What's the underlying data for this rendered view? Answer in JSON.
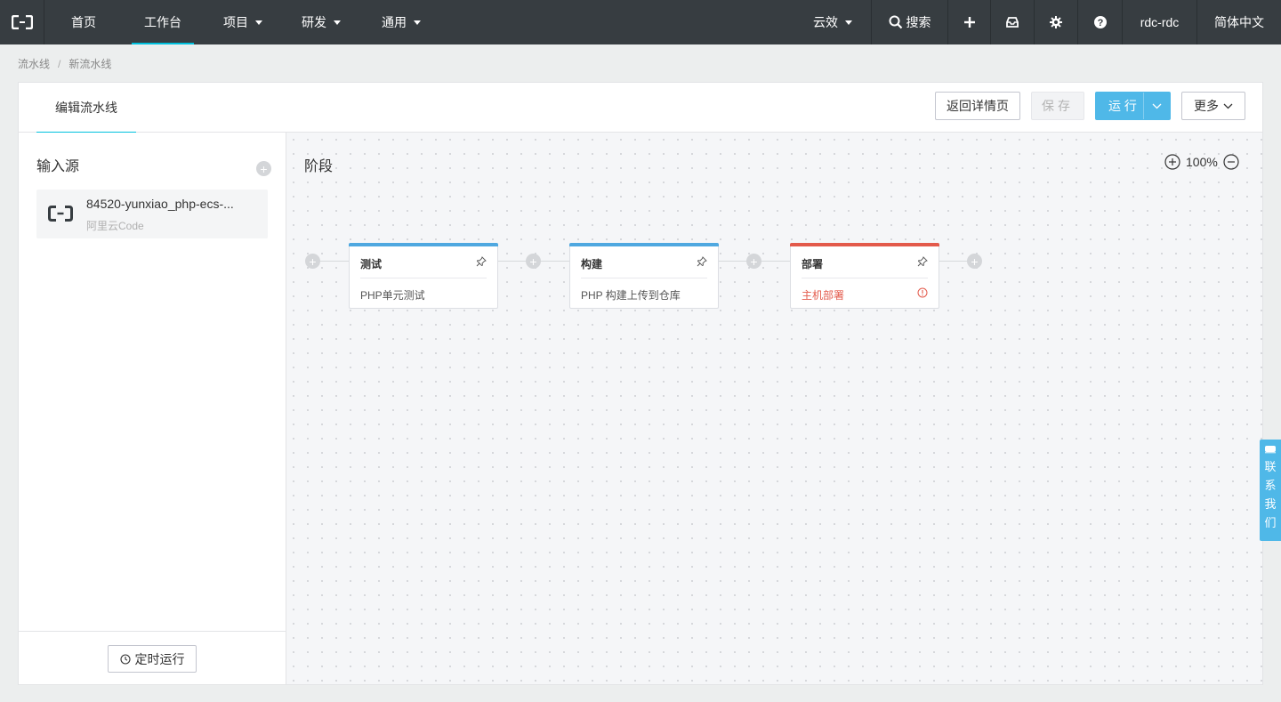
{
  "topbar": {
    "nav": [
      {
        "label": "首页"
      },
      {
        "label": "工作台"
      },
      {
        "label": "项目"
      },
      {
        "label": "研发"
      },
      {
        "label": "通用"
      }
    ],
    "org_label": "云效",
    "search_label": "搜索",
    "user_label": "rdc-rdc",
    "language_label": "简体中文"
  },
  "breadcrumb": {
    "items": [
      "流水线",
      "新流水线"
    ],
    "separator": "/"
  },
  "header": {
    "tab_label": "编辑流水线",
    "back_label": "返回详情页",
    "save_label": "保存",
    "run_label": "运 行",
    "more_label": "更多"
  },
  "left_panel": {
    "title": "输入源",
    "source": {
      "name": "84520-yunxiao_php-ecs-...",
      "type": "阿里云Code"
    },
    "schedule_label": "定时运行"
  },
  "canvas": {
    "title": "阶段",
    "zoom_label": "100%",
    "stages": [
      {
        "name": "测试",
        "task": "PHP单元测试",
        "color": "#4fa8e0",
        "status": "normal"
      },
      {
        "name": "构建",
        "task": "PHP 构建上传到仓库",
        "color": "#4fa8e0",
        "status": "normal"
      },
      {
        "name": "部署",
        "task": "主机部署",
        "color": "#e35a4b",
        "status": "error"
      }
    ]
  },
  "contact": {
    "label_chars": [
      "联",
      "系",
      "我",
      "们"
    ]
  },
  "colors": {
    "topbar": "#373d41",
    "accent": "#00c1de",
    "primary_button": "#4fb8e8",
    "error": "#e35a4b"
  }
}
